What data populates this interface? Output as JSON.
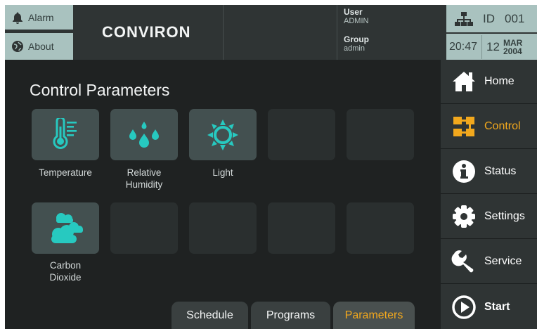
{
  "header": {
    "alarm_label": "Alarm",
    "about_label": "About",
    "logo": "CONVIRON",
    "user_key": "User",
    "user_value": "ADMIN",
    "group_key": "Group",
    "group_value": "admin",
    "id_label": "ID",
    "id_value": "001",
    "time": "20:47",
    "day": "12",
    "month": "MAR",
    "year": "2004"
  },
  "page_title": "Control Parameters",
  "tiles": [
    {
      "label": "Temperature",
      "icon": "thermometer-icon"
    },
    {
      "label": "Relative\nHumidity",
      "icon": "water-drops-icon"
    },
    {
      "label": "Light",
      "icon": "sun-icon"
    },
    {
      "label": "Carbon\nDioxide",
      "icon": "clouds-icon"
    }
  ],
  "tabs": [
    {
      "label": "Schedule"
    },
    {
      "label": "Programs"
    },
    {
      "label": "Parameters",
      "selected": true
    }
  ],
  "nav": [
    {
      "label": "Home",
      "icon": "home-icon"
    },
    {
      "label": "Control",
      "icon": "control-icon",
      "active": true
    },
    {
      "label": "Status",
      "icon": "info-icon"
    },
    {
      "label": "Settings",
      "icon": "gear-icon"
    },
    {
      "label": "Service",
      "icon": "wrench-icon"
    },
    {
      "label": "Start",
      "icon": "play-icon"
    }
  ],
  "colors": {
    "accent": "#f2a81d",
    "teal": "#27c9c0",
    "header_button": "#a9c2bf",
    "background": "#1f2222"
  }
}
